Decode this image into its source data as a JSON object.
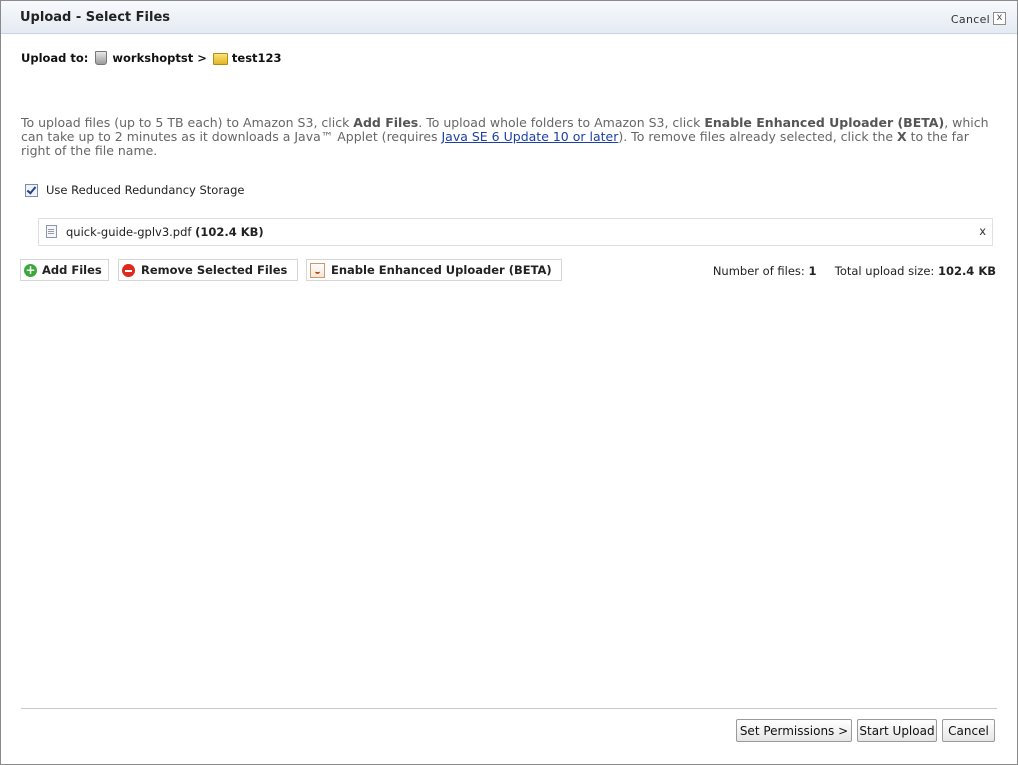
{
  "dialog": {
    "title": "Upload - Select Files",
    "cancel_label": "Cancel",
    "close_label": "x"
  },
  "upload_to": {
    "label": "Upload to:",
    "bucket": "workshoptst",
    "separator": ">",
    "folder": "test123"
  },
  "info": {
    "part1": "To upload files (up to 5 TB each) to Amazon S3, click ",
    "add_files": "Add Files",
    "part2": ". To upload whole folders to Amazon S3, click ",
    "enhanced": "Enable Enhanced Uploader (BETA)",
    "part3": ", which can take up to 2 minutes as it downloads a Java™ Applet (requires ",
    "java_link": "Java SE 6 Update 10 or later",
    "part4": "). To remove files already selected, click the ",
    "x": "X",
    "part5": " to the far right of the file name."
  },
  "rrs": {
    "label": "Use Reduced Redundancy Storage",
    "checked": true
  },
  "files": [
    {
      "name": "quick-guide-gplv3.pdf",
      "size": "(102.4 KB)",
      "remove": "x"
    }
  ],
  "toolbar": {
    "add_files": "Add Files",
    "remove_selected": "Remove Selected Files",
    "enable_enhanced": "Enable Enhanced Uploader (BETA)"
  },
  "stats": {
    "count_label": "Number of files:",
    "count": "1",
    "size_label": "Total upload size:",
    "size": "102.4 KB"
  },
  "footer": {
    "set_permissions": "Set Permissions >",
    "start_upload": "Start Upload",
    "cancel": "Cancel"
  }
}
